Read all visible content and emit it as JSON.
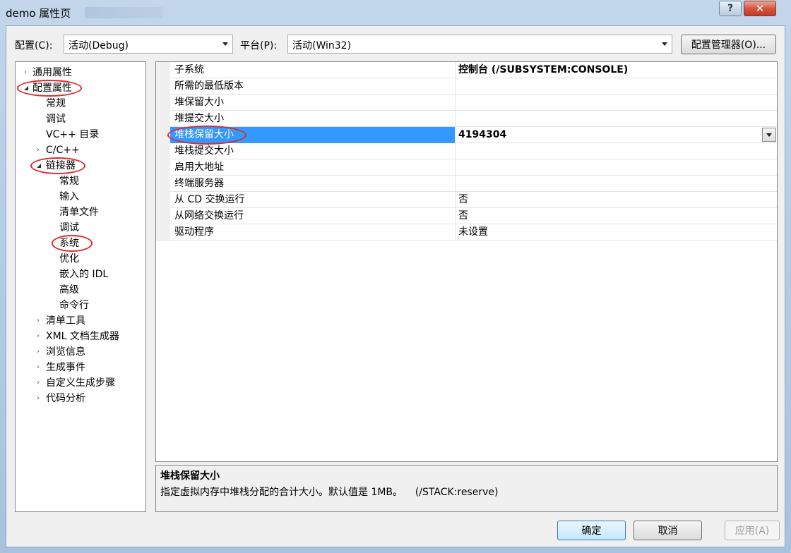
{
  "window": {
    "title": "demo 属性页",
    "help_label": "?",
    "close_label": "✕"
  },
  "toolbar": {
    "config_label": "配置(C):",
    "config_value": "活动(Debug)",
    "platform_label": "平台(P):",
    "platform_value": "活动(Win32)",
    "config_manager_label": "配置管理器(O)..."
  },
  "tree": {
    "items": [
      {
        "label": "通用属性",
        "expander": "›",
        "level": 0
      },
      {
        "label": "配置属性",
        "expander": "◢",
        "level": 0,
        "circled": true
      },
      {
        "label": "常规",
        "expander": "",
        "level": 1
      },
      {
        "label": "调试",
        "expander": "",
        "level": 1
      },
      {
        "label": "VC++ 目录",
        "expander": "",
        "level": 1
      },
      {
        "label": "C/C++",
        "expander": "›",
        "level": 1
      },
      {
        "label": "链接器",
        "expander": "◢",
        "level": 1,
        "circled": true
      },
      {
        "label": "常规",
        "expander": "",
        "level": 2
      },
      {
        "label": "输入",
        "expander": "",
        "level": 2
      },
      {
        "label": "清单文件",
        "expander": "",
        "level": 2
      },
      {
        "label": "调试",
        "expander": "",
        "level": 2
      },
      {
        "label": "系统",
        "expander": "",
        "level": 2,
        "circled": true
      },
      {
        "label": "优化",
        "expander": "",
        "level": 2
      },
      {
        "label": "嵌入的 IDL",
        "expander": "",
        "level": 2
      },
      {
        "label": "高级",
        "expander": "",
        "level": 2
      },
      {
        "label": "命令行",
        "expander": "",
        "level": 2
      },
      {
        "label": "清单工具",
        "expander": "›",
        "level": 1
      },
      {
        "label": "XML 文档生成器",
        "expander": "›",
        "level": 1
      },
      {
        "label": "浏览信息",
        "expander": "›",
        "level": 1
      },
      {
        "label": "生成事件",
        "expander": "›",
        "level": 1
      },
      {
        "label": "自定义生成步骤",
        "expander": "›",
        "level": 1
      },
      {
        "label": "代码分析",
        "expander": "›",
        "level": 1
      }
    ]
  },
  "properties": {
    "rows": [
      {
        "name": "子系统",
        "value": "控制台 (/SUBSYSTEM:CONSOLE)",
        "bold": true
      },
      {
        "name": "所需的最低版本",
        "value": ""
      },
      {
        "name": "堆保留大小",
        "value": ""
      },
      {
        "name": "堆提交大小",
        "value": ""
      },
      {
        "name": "堆栈保留大小",
        "value": "4194304",
        "bold": true,
        "selected": true
      },
      {
        "name": "堆栈提交大小",
        "value": ""
      },
      {
        "name": "启用大地址",
        "value": ""
      },
      {
        "name": "终端服务器",
        "value": ""
      },
      {
        "name": "从 CD 交换运行",
        "value": "否"
      },
      {
        "name": "从网络交换运行",
        "value": "否"
      },
      {
        "name": "驱动程序",
        "value": "未设置"
      }
    ]
  },
  "description": {
    "title": "堆栈保留大小",
    "text": "指定虚拟内存中堆栈分配的合计大小。默认值是 1MB。    (/STACK:reserve)"
  },
  "buttons": {
    "ok": "确定",
    "cancel": "取消",
    "apply": "应用(A)"
  },
  "colors": {
    "selection": "#3399ff",
    "annotation_circle": "#e0282b"
  }
}
